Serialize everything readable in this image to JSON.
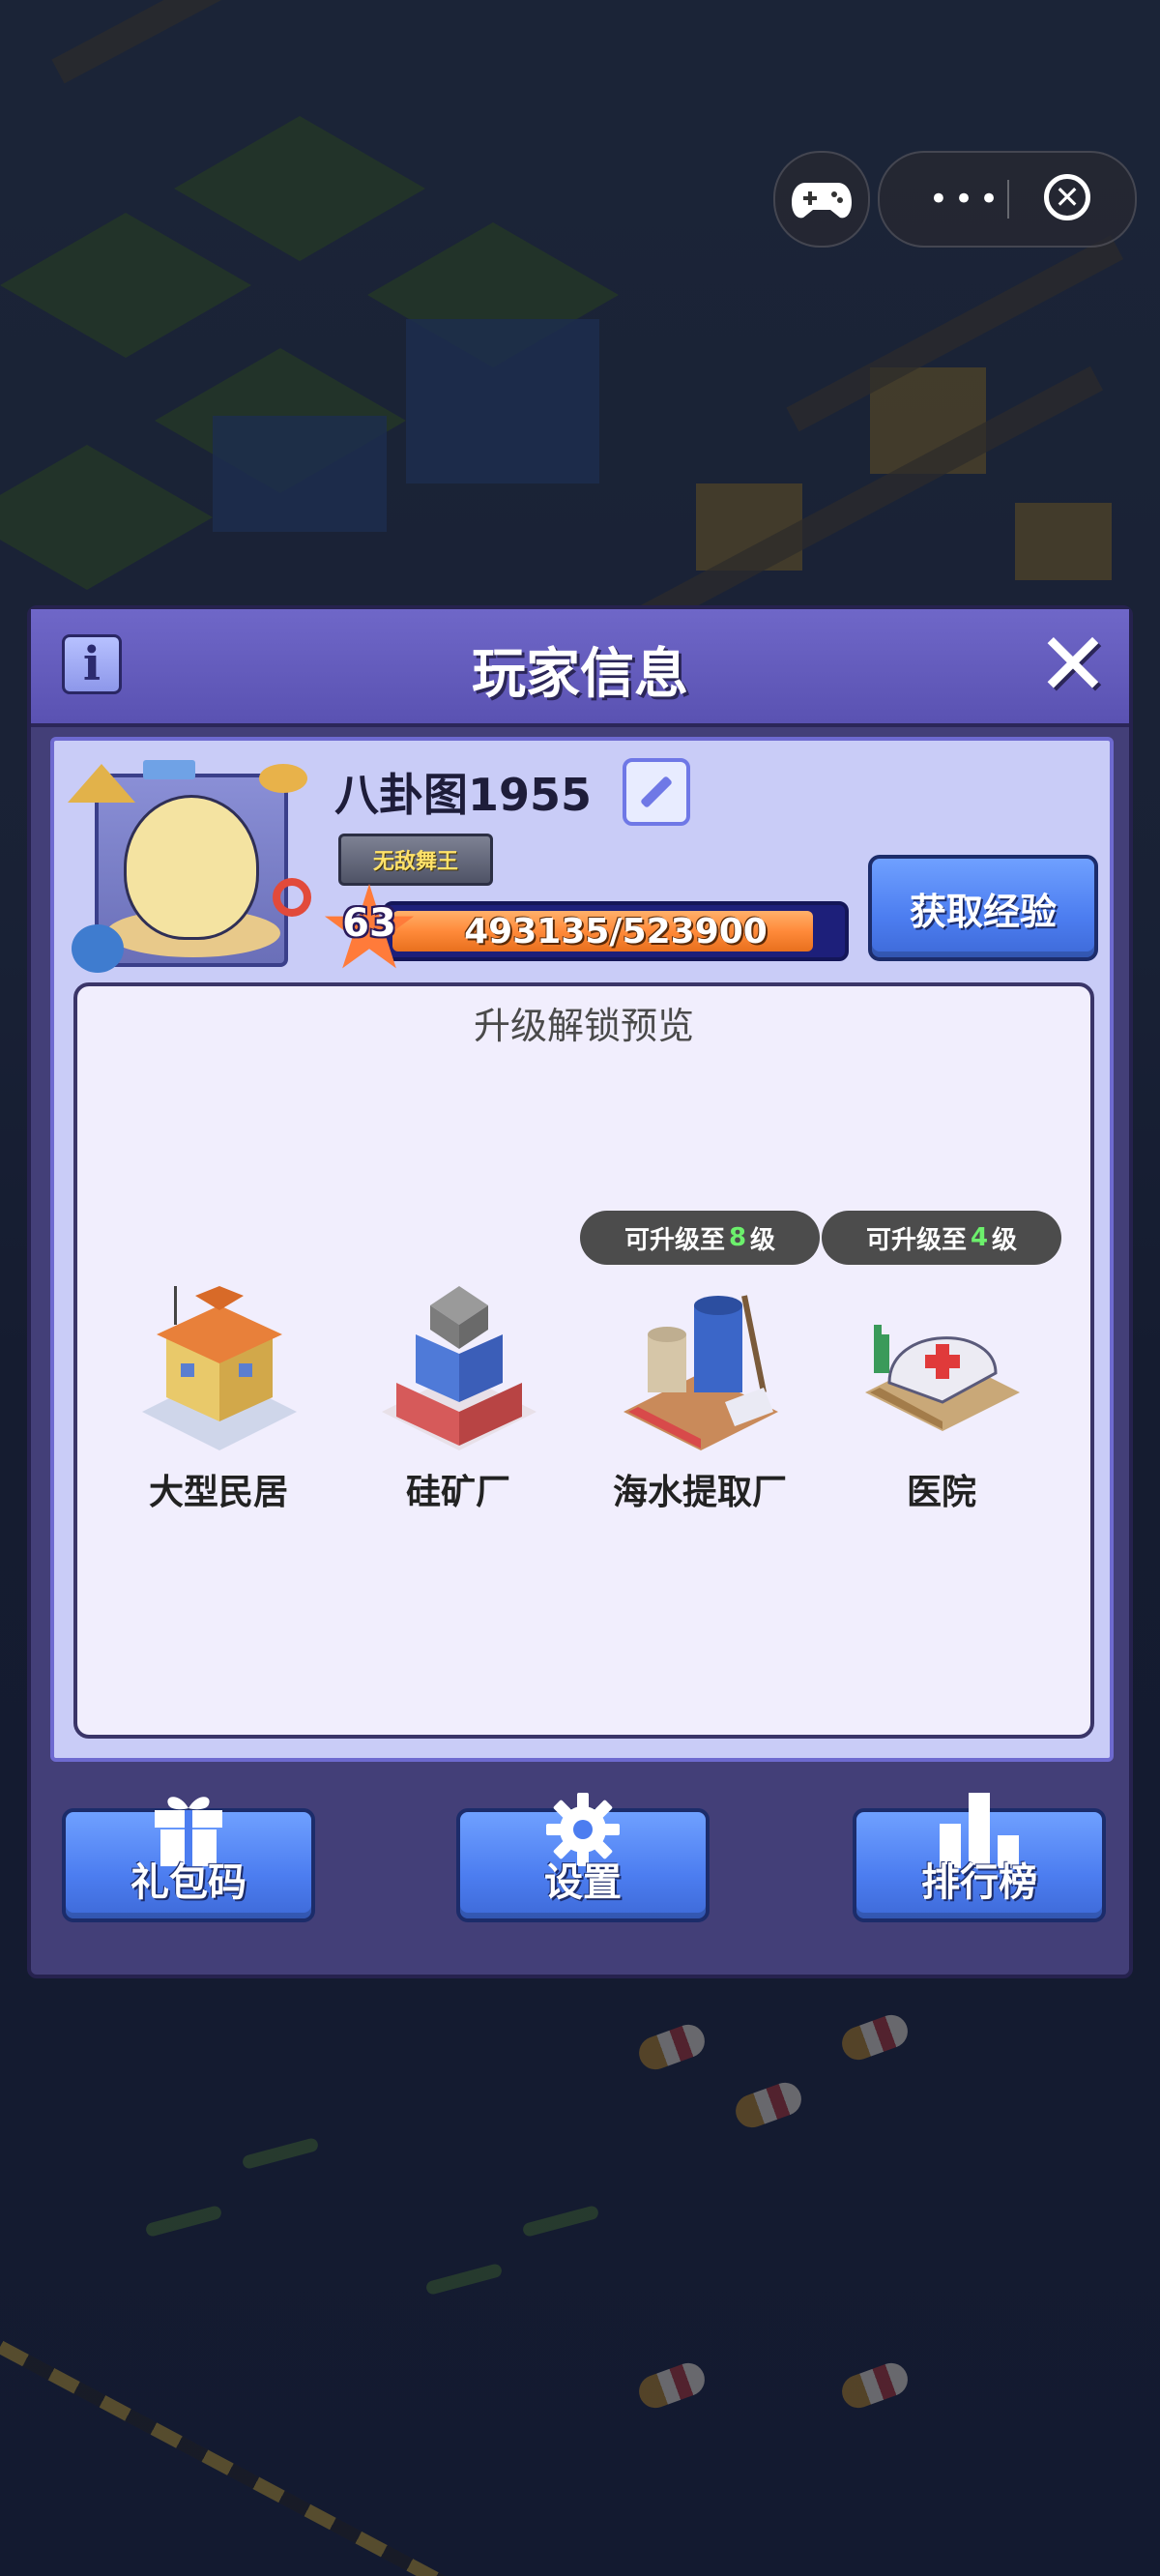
{
  "dialog": {
    "title": "玩家信息",
    "info_icon": "i",
    "close_icon": "✕"
  },
  "player": {
    "name": "八卦图1955",
    "title_badge": "无敌舞王",
    "level": "63",
    "exp_text": "493135/523900",
    "exp_progress": 0.941
  },
  "gain_exp_button": "获取经验",
  "preview": {
    "title": "升级解锁预览",
    "buildings": [
      {
        "name": "大型民居",
        "tag": null,
        "icon": "house-icon"
      },
      {
        "name": "硅矿厂",
        "tag": null,
        "icon": "silicon-mine-icon"
      },
      {
        "name": "海水提取厂",
        "tag": {
          "prefix": "可升级至",
          "level": "8",
          "suffix": "级"
        },
        "icon": "seawater-plant-icon"
      },
      {
        "name": "医院",
        "tag": {
          "prefix": "可升级至",
          "level": "4",
          "suffix": "级"
        },
        "icon": "hospital-icon"
      }
    ]
  },
  "bottom_buttons": [
    {
      "label": "礼包码",
      "icon": "gift-icon"
    },
    {
      "label": "设置",
      "icon": "gear-icon"
    },
    {
      "label": "排行榜",
      "icon": "leaderboard-icon"
    }
  ],
  "capsule": {
    "more_icon": "•••",
    "close_icon": "✕"
  },
  "colors": {
    "header": "#6f67c8",
    "panel": "#c9ccf7",
    "button": "#4c7df0",
    "exp_fill": "#ff8a3a",
    "level_star": "#ff7b3a"
  }
}
